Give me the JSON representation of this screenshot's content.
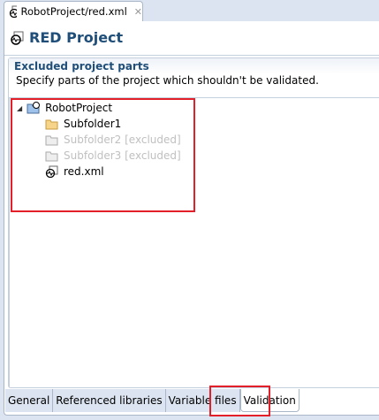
{
  "editor_tab": {
    "title": "RobotProject/red.xml",
    "icon": "robot-file-icon",
    "close_icon": "close-icon"
  },
  "header": {
    "title": "RED Project"
  },
  "section": {
    "title": "Excluded project parts",
    "description": "Specify parts of the project which shouldn't be validated."
  },
  "tree": {
    "root": "RobotProject",
    "children": [
      {
        "label": "Subfolder1",
        "excluded": false,
        "icon": "folder-icon"
      },
      {
        "label": "Subfolder2 [excluded]",
        "excluded": true,
        "icon": "folder-icon"
      },
      {
        "label": "Subfolder3 [excluded]",
        "excluded": true,
        "icon": "folder-icon"
      },
      {
        "label": "red.xml",
        "excluded": false,
        "icon": "robot-file-icon"
      }
    ]
  },
  "bottom_tabs": [
    "General",
    "Referenced libraries",
    "Variable files",
    "Validation"
  ],
  "active_tab": "Validation",
  "colors": {
    "highlight": "#e3202a",
    "title": "#1f4e79"
  }
}
